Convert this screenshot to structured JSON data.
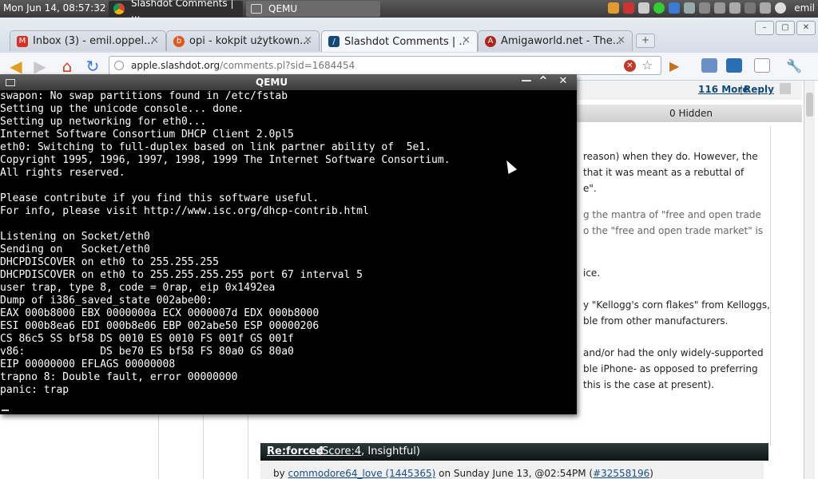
{
  "system_panel": {
    "clock": "Mon Jun 14, 08:57:32",
    "tasks": [
      "Slashdot Comments | ...",
      "QEMU"
    ],
    "user": "emil"
  },
  "browser": {
    "tabs": [
      {
        "title": "Inbox (3) - emil.oppel...",
        "favicon": "gmail-icon",
        "color": "#d93025"
      },
      {
        "title": "opi - kokpit użytkown...",
        "favicon": "opera-icon",
        "color": "#e2561f"
      },
      {
        "title": "Slashdot Comments | ...",
        "favicon": "slashdot-icon",
        "color": "#11497a"
      },
      {
        "title": "Amigaworld.net - The...",
        "favicon": "amigaworld-icon",
        "color": "#b2231b"
      }
    ],
    "close_glyph": "×",
    "newtab_glyph": "+",
    "url_host": "apple.slashdot.org",
    "url_path": "/comments.pl?sid=1684454",
    "window_controls": [
      "–",
      "▢",
      "✕"
    ]
  },
  "page": {
    "more_link": "116 More",
    "separator": "|",
    "reply_link": "Reply",
    "hidden_label": "0 Hidden",
    "lines": [
      {
        "text": "reason) when they do. However, the",
        "gray": false
      },
      {
        "text": "that it was meant as a rebuttal of",
        "gray": false
      },
      {
        "text": "e\".",
        "gray": false
      },
      {
        "text": "g the mantra of \"free and open trade",
        "gray": true
      },
      {
        "text": "o the \"free and open trade market\" is",
        "gray": true
      },
      {
        "text": "ice.",
        "gray": false
      },
      {
        "text": "y \"Kellogg's corn flakes\" from Kelloggs,",
        "gray": false
      },
      {
        "text": "ble from other manufacturers.",
        "gray": false
      },
      {
        "text": "and/or had the only widely-supported",
        "gray": false
      },
      {
        "text": "ble iPhone- as opposed to preferring",
        "gray": false
      },
      {
        "text": "this is the case at present).",
        "gray": false
      }
    ],
    "comment": {
      "title": "Re:forced",
      "score_open": "(",
      "score_link": "Score:4",
      "score_rest": ", Insightful)",
      "by_prefix": "by ",
      "author": "commodore64_love (1445365)",
      "date_text": " on Sunday June 13, @02:54PM (",
      "cid": "#32558196",
      "close": ")"
    }
  },
  "qemu": {
    "title": "QEMU",
    "controls": [
      "—",
      "^",
      "✕"
    ],
    "console_lines": [
      "swapon: No swap partitions found in /etc/fstab",
      "Setting up the unicode console... done.",
      "Setting up networking for eth0...",
      "Internet Software Consortium DHCP Client 2.0pl5",
      "eth0: Switching to full-duplex based on link partner ability of  5e1.",
      "Copyright 1995, 1996, 1997, 1998, 1999 The Internet Software Consortium.",
      "All rights reserved.",
      "",
      "Please contribute if you find this software useful.",
      "For info, please visit http://www.isc.org/dhcp-contrib.html",
      "",
      "Listening on Socket/eth0",
      "Sending on   Socket/eth0",
      "DHCPDISCOVER on eth0 to 255.255.255",
      "DHCPDISCOVER on eth0 to 255.255.255.255 port 67 interval 5",
      "user trap, type 8, code = 0rap, eip 0x1492ea",
      "Dump of i386_saved_state 002abe00:",
      "EAX 000b8000 EBX 0000000a ECX 0000007d EDX 000b8000",
      "ESI 000b8ea6 EDI 000b8e06 EBP 002abe50 ESP 00000206",
      "CS 86c5 SS bf58 DS 0010 ES 0010 FS 001f GS 001f",
      "v86:            DS be70 ES bf58 FS 80a0 GS 80a0",
      "EIP 00000000 EFLAGS 00000008",
      "trapno 8: Double fault, error 00000000",
      "panic: trap"
    ]
  }
}
